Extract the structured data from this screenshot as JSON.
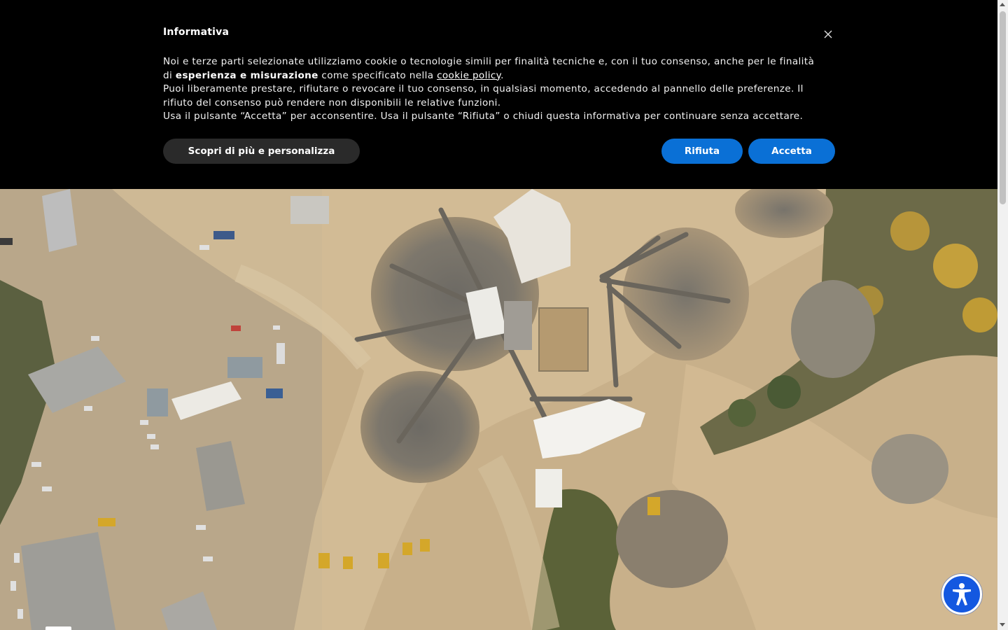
{
  "cookie_banner": {
    "title": "Informativa",
    "close_icon": "close-icon",
    "line1_before": "Noi e terze parti selezionate utilizziamo cookie o tecnologie simili per finalità tecniche e, con il tuo consenso, anche per le finalità di ",
    "line1_bold": "esperienza e misurazione",
    "line1_middle": " come specificato nella ",
    "line1_link": "cookie policy",
    "line1_after": ".",
    "line2": "Puoi liberamente prestare, rifiutare o revocare il tuo consenso, in qualsiasi momento, accedendo al pannello delle preferenze. Il rifiuto del consenso può rendere non disponibili le relative funzioni.",
    "line3": "Usa il pulsante “Accetta” per acconsentire. Usa il pulsante “Rifiuta” o chiudi questa informativa per continuare senza accettare.",
    "btn_customize": "Scopri di più e personalizza",
    "btn_reject": "Rifiuta",
    "btn_accept": "Accetta",
    "accent_color": "#0a70d6"
  },
  "accessibility_button": {
    "icon": "accessibility-person-icon",
    "color": "#1458e0"
  },
  "hero": {
    "image": "aerial-quarry-video"
  }
}
